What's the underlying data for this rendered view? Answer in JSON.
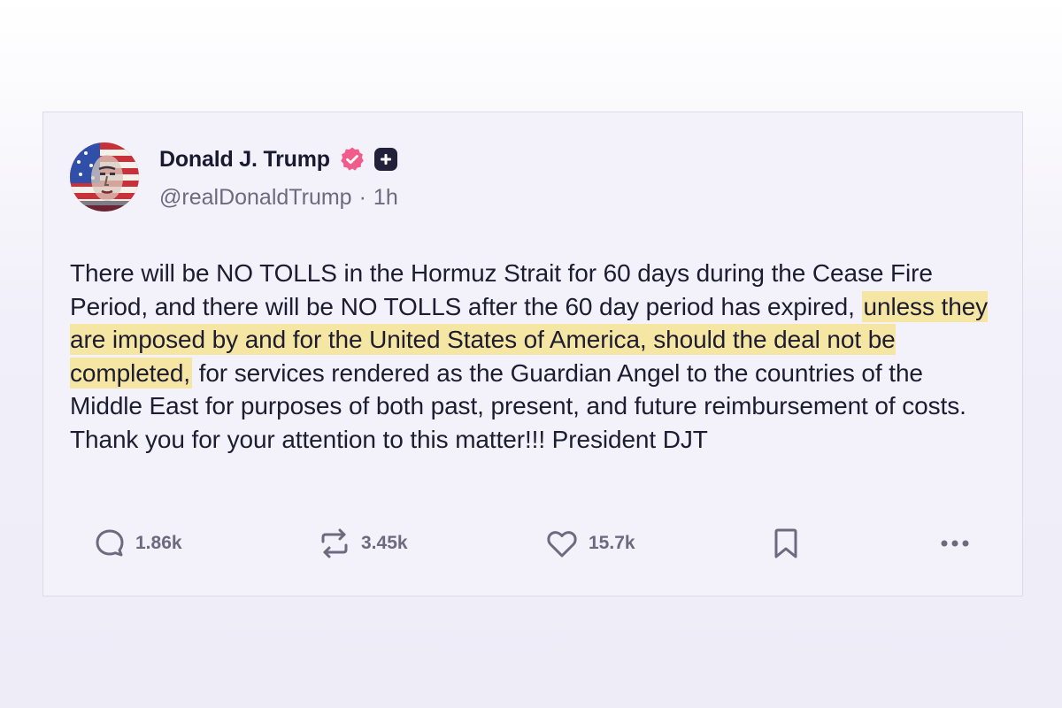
{
  "post": {
    "author": {
      "display_name": "Donald J. Trump",
      "handle": "@realDonaldTrump",
      "separator": "·",
      "time": "1h",
      "verified_icon": "verified-badge-icon",
      "plus_icon": "plus-badge-icon"
    },
    "text": {
      "part1": "There will be NO TOLLS in the  Hormuz Strait for 60 days during the Cease Fire Period, and there will be NO TOLLS after the 60 day period has expired, ",
      "highlighted": "unless they are imposed by and for the United States of America, should the deal not be completed,",
      "part2": " for services rendered as the Guardian Angel to the countries of the Middle East for purposes of both past, present, and future reimbursement of costs. Thank you for your attention to this matter!!! President DJT"
    },
    "actions": {
      "replies": "1.86k",
      "reposts": "3.45k",
      "likes": "15.7k"
    }
  },
  "colors": {
    "highlight": "#f5e6a3",
    "verified": "#f25c8a",
    "text": "#1d1c30",
    "muted": "#6d6a80"
  }
}
